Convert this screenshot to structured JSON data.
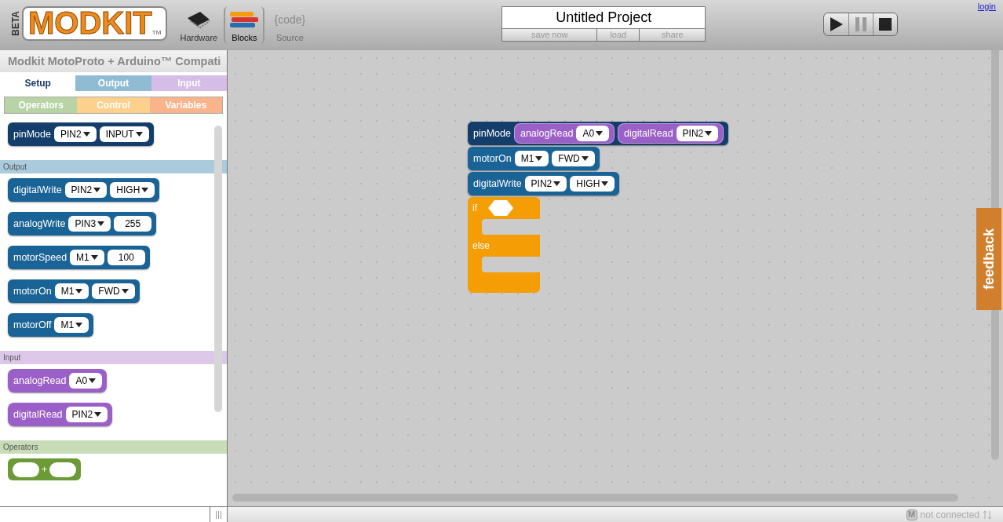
{
  "header": {
    "logo": {
      "badge": "BETA",
      "wordmark": "MODKIT",
      "tm": "TM"
    },
    "nav": [
      {
        "kind": "hardware",
        "label": "Hardware",
        "selected": false,
        "disabled": false
      },
      {
        "kind": "blocks",
        "label": "Blocks",
        "selected": true,
        "disabled": false
      },
      {
        "kind": "source",
        "icon_text": "{code}",
        "label": "Source",
        "selected": false,
        "disabled": true
      }
    ],
    "project": {
      "title": "Untitled Project",
      "actions": [
        {
          "label": "save now",
          "disabled": true
        },
        {
          "label": "load",
          "disabled": true
        },
        {
          "label": "share",
          "disabled": true
        }
      ]
    },
    "run_controls": [
      {
        "kind": "play",
        "disabled": false
      },
      {
        "kind": "pause",
        "disabled": true
      },
      {
        "kind": "stop",
        "disabled": false
      }
    ],
    "login": "login"
  },
  "sidebar": {
    "title": "Modkit MotoProto + Arduino™ Compati",
    "tab_rows": [
      [
        {
          "label": "Setup",
          "selected": true
        },
        {
          "label": "Output",
          "color": "#8fbcd2",
          "selected": false
        },
        {
          "label": "Input",
          "color": "#d5bde8",
          "selected": false
        }
      ],
      [
        {
          "label": "Operators",
          "color": "#b8d3a4",
          "selected": false
        },
        {
          "label": "Control",
          "color": "#fdd08c",
          "selected": false
        },
        {
          "label": "Variables",
          "color": "#f9b48b",
          "selected": false
        }
      ]
    ],
    "sections": [
      {
        "blocks": [
          {
            "kind": "command",
            "label": "pinMode",
            "color": "#133d6b",
            "args": [
              {
                "kind": "dropdown",
                "value": "PIN2"
              },
              {
                "kind": "dropdown",
                "value": "INPUT"
              }
            ]
          }
        ]
      },
      {
        "heading": "Output",
        "color": "#a9cbdc",
        "blocks": [
          {
            "kind": "command",
            "label": "digitalWrite",
            "color": "#1a6396",
            "args": [
              {
                "kind": "dropdown",
                "value": "PIN2"
              },
              {
                "kind": "dropdown",
                "value": "HIGH"
              }
            ]
          },
          {
            "kind": "command",
            "label": "analogWrite",
            "color": "#1a6396",
            "args": [
              {
                "kind": "dropdown",
                "value": "PIN3"
              },
              {
                "kind": "number",
                "value": "255"
              }
            ]
          },
          {
            "kind": "command",
            "label": "motorSpeed",
            "color": "#1a6396",
            "args": [
              {
                "kind": "dropdown",
                "value": "M1"
              },
              {
                "kind": "number",
                "value": "100"
              }
            ]
          },
          {
            "kind": "command",
            "label": "motorOn",
            "color": "#1a6396",
            "args": [
              {
                "kind": "dropdown",
                "value": "M1"
              },
              {
                "kind": "dropdown",
                "value": "FWD"
              }
            ]
          },
          {
            "kind": "command",
            "label": "motorOff",
            "color": "#1a6396",
            "args": [
              {
                "kind": "dropdown",
                "value": "M1"
              }
            ]
          }
        ]
      },
      {
        "heading": "Input",
        "color": "#dcc9ea",
        "blocks": [
          {
            "kind": "reporter",
            "label": "analogRead",
            "color": "#9b5fc8",
            "args": [
              {
                "kind": "dropdown",
                "value": "A0"
              }
            ]
          },
          {
            "kind": "reporter",
            "label": "digitalRead",
            "color": "#9b5fc8",
            "args": [
              {
                "kind": "dropdown",
                "value": "PIN2"
              }
            ]
          }
        ]
      },
      {
        "heading": "Operators",
        "color": "#c9dcb8",
        "blocks": [
          {
            "kind": "operator",
            "symbol": "+",
            "color": "#6b9a37"
          }
        ]
      }
    ]
  },
  "canvas": {
    "stack": [
      {
        "kind": "command",
        "label": "pinMode",
        "color": "#133d6b",
        "args": [
          {
            "kind": "block",
            "block": {
              "kind": "reporter",
              "label": "analogRead",
              "color": "#9b5fc8",
              "args": [
                {
                  "kind": "dropdown",
                  "value": "A0"
                }
              ]
            }
          },
          {
            "kind": "block",
            "block": {
              "kind": "reporter",
              "label": "digitalRead",
              "color": "#9b5fc8",
              "args": [
                {
                  "kind": "dropdown",
                  "value": "PIN2"
                }
              ]
            }
          }
        ]
      },
      {
        "kind": "command",
        "label": "motorOn",
        "color": "#1a6396",
        "args": [
          {
            "kind": "dropdown",
            "value": "M1"
          },
          {
            "kind": "dropdown",
            "value": "FWD"
          }
        ]
      },
      {
        "kind": "command",
        "label": "digitalWrite",
        "color": "#1a6396",
        "args": [
          {
            "kind": "dropdown",
            "value": "PIN2"
          },
          {
            "kind": "dropdown",
            "value": "HIGH"
          }
        ]
      },
      {
        "kind": "if_else",
        "labels": [
          "if",
          "else"
        ],
        "color": "#f59d05"
      }
    ],
    "feedback": "feedback"
  },
  "status_bar": {
    "badge": "M",
    "text": "not connected"
  }
}
